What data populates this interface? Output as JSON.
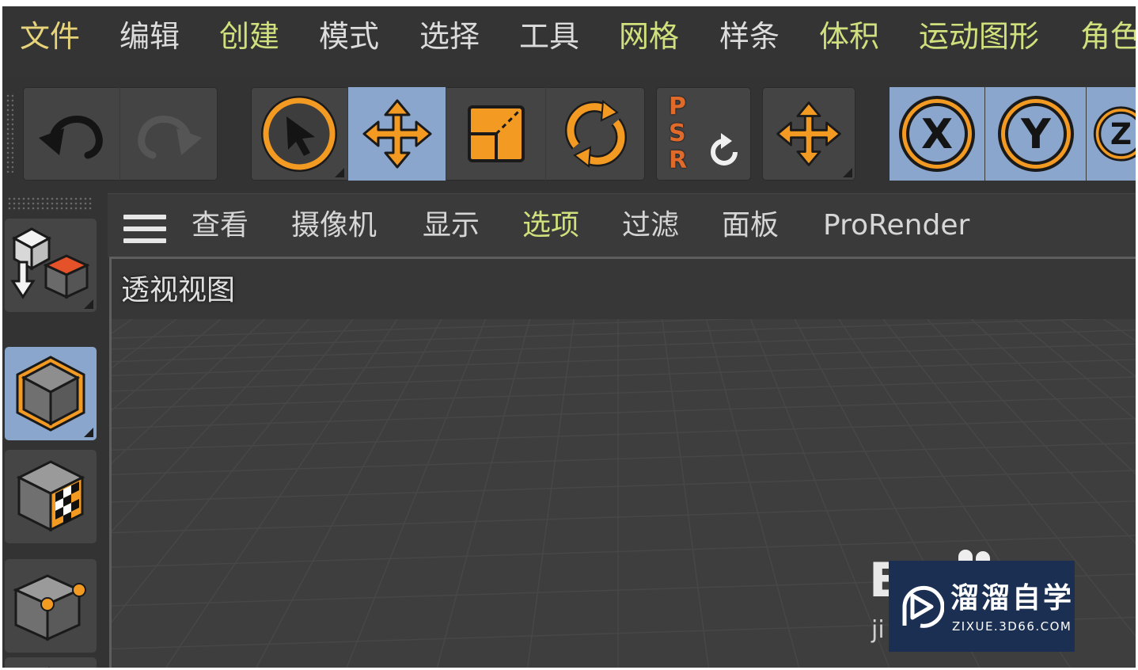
{
  "menubar": {
    "items": [
      {
        "label": "文件",
        "color": "#e6d37a"
      },
      {
        "label": "编辑",
        "color": "#dcdcdc"
      },
      {
        "label": "创建",
        "color": "#cfe07c"
      },
      {
        "label": "模式",
        "color": "#dcdcdc"
      },
      {
        "label": "选择",
        "color": "#dcdcdc"
      },
      {
        "label": "工具",
        "color": "#dcdcdc"
      },
      {
        "label": "网格",
        "color": "#cfe07c"
      },
      {
        "label": "样条",
        "color": "#dcdcdc"
      },
      {
        "label": "体积",
        "color": "#cfe07c"
      },
      {
        "label": "运动图形",
        "color": "#cfe07c"
      },
      {
        "label": "角色",
        "color": "#cfe07c"
      }
    ]
  },
  "toolbar": {
    "undo_icon": "undo-icon",
    "redo_icon": "redo-icon",
    "psr_letters": [
      "P",
      "S",
      "R"
    ],
    "axis_labels": [
      "X",
      "Y",
      "Z"
    ],
    "active_color": "#8aa6cc",
    "accent_color": "#f29a22"
  },
  "viewport": {
    "menu": {
      "items": [
        "查看",
        "摄像机",
        "显示",
        "选项",
        "过滤",
        "面板",
        "ProRender"
      ]
    },
    "menu_highlight": "选项",
    "title": "透视视图"
  },
  "watermark": {
    "main": "溜溜自学",
    "sub": "ZIXUE.3D66.COM",
    "back_letter": "E",
    "back_text": "ji"
  }
}
